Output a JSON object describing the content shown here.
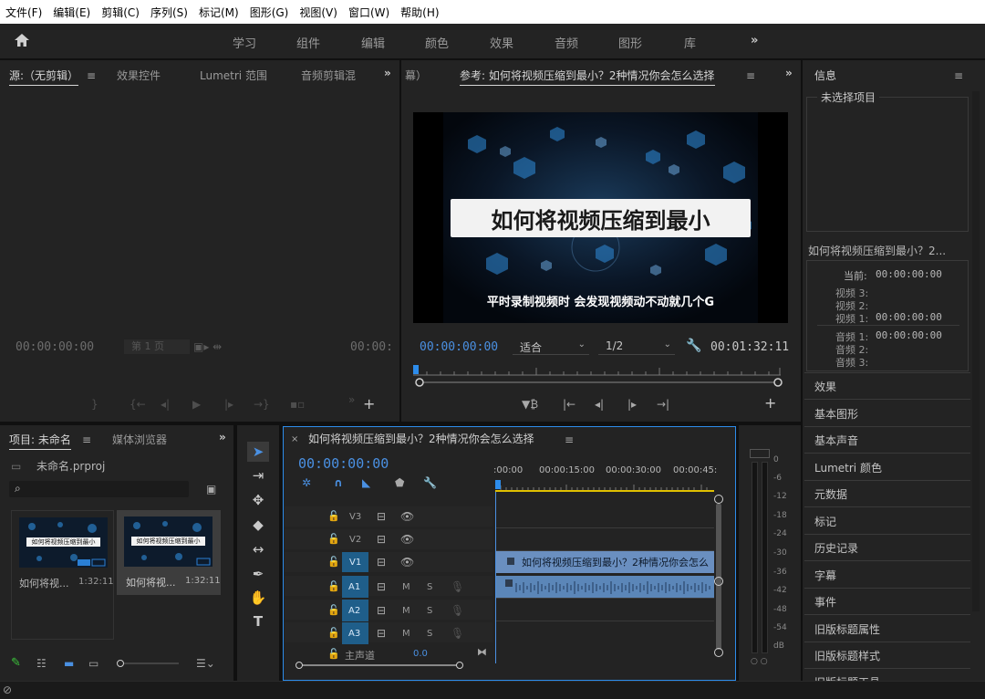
{
  "menu": [
    "文件(F)",
    "编辑(E)",
    "剪辑(C)",
    "序列(S)",
    "标记(M)",
    "图形(G)",
    "视图(V)",
    "窗口(W)",
    "帮助(H)"
  ],
  "workspaces": [
    "学习",
    "组件",
    "编辑",
    "颜色",
    "效果",
    "音频",
    "图形",
    "库"
  ],
  "source_panel": {
    "tabs": [
      "源:（无剪辑）",
      "效果控件",
      "Lumetri 范围",
      "音频剪辑混"
    ],
    "timecode_left": "00:00:00:00",
    "page": "第 1 页",
    "timecode_right": "00:00:"
  },
  "program_panel": {
    "tab_overflow": "幕）",
    "title": "参考: 如何将视频压缩到最小？2种情况你会怎么选择",
    "video_title": "如何将视频压缩到最小",
    "video_subtitle": "平时录制视频时 会发现视频动不动就几个G",
    "timecode": "00:00:00:00",
    "fit": "适合",
    "resolution": "1/2",
    "duration": "00:01:32:11"
  },
  "info_panel": {
    "title": "信息",
    "no_selection": "未选择项目",
    "clip_name": "如何将视频压缩到最小？2...",
    "current_label": "当前:",
    "current_value": "00:00:00:00",
    "video3": "视频 3:",
    "video2": "视频 2:",
    "video1": "视频 1:",
    "video1_value": "00:00:00:00",
    "audio1": "音频 1:",
    "audio1_value": "00:00:00:00",
    "audio2": "音频 2:",
    "audio3": "音频 3:"
  },
  "side_panels": [
    "效果",
    "基本图形",
    "基本声音",
    "Lumetri 颜色",
    "元数据",
    "标记",
    "历史记录",
    "字幕",
    "事件",
    "旧版标题属性",
    "旧版标题样式",
    "旧版标题工具"
  ],
  "project_panel": {
    "tab_project": "项目: 未命名",
    "tab_media": "媒体浏览器",
    "project_file": "未命名.prproj",
    "items": [
      {
        "name": "如何将视...",
        "duration": "1:32:11",
        "thumb_title": "如何将视频压缩到最小"
      },
      {
        "name": "如何将视...",
        "duration": "1:32:11",
        "thumb_title": "如何将视频压缩到最小"
      }
    ]
  },
  "timeline": {
    "title": "如何将视频压缩到最小？2种情况你会怎么选择",
    "timecode": "00:00:00:00",
    "ruler": [
      ":00:00",
      "00:00:15:00",
      "00:00:30:00",
      "00:00:45:"
    ],
    "video_tracks": [
      "V3",
      "V2",
      "V1"
    ],
    "audio_tracks": [
      "A1",
      "A2",
      "A3"
    ],
    "mute_label": "M",
    "solo_label": "S",
    "clip_label": "如何将视频压缩到最小？2种情况你会怎么",
    "master_label": "主声道",
    "master_value": "0.0"
  },
  "meter_scale": [
    "0",
    "-6",
    "-12",
    "-18",
    "-24",
    "-30",
    "-36",
    "-42",
    "-48",
    "-54",
    "dB"
  ],
  "meter_bottom": "○ ○",
  "colors": {
    "accent": "#2d8ceb",
    "timecode": "#4a90e2",
    "clip_video": "#6a8fc0",
    "clip_audio": "#5b86b8",
    "track_active": "#1f5e8a"
  }
}
